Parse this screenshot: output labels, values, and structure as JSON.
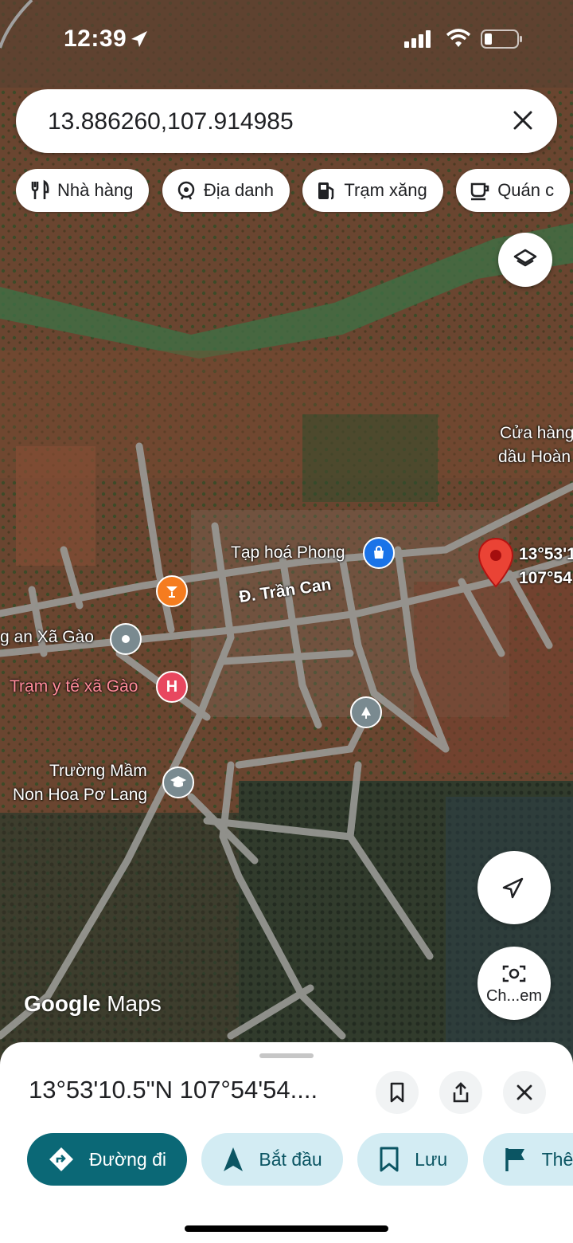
{
  "status_bar": {
    "time": "12:39"
  },
  "search": {
    "value": "13.886260,107.914985"
  },
  "chips": [
    {
      "label": "Nhà hàng",
      "icon": "fork-knife-icon"
    },
    {
      "label": "Địa danh",
      "icon": "landmark-icon"
    },
    {
      "label": "Trạm xăng",
      "icon": "gas-station-icon"
    },
    {
      "label": "Quán c",
      "icon": "coffee-icon"
    }
  ],
  "map": {
    "street_label": "Đ. Trần Can",
    "places": {
      "shop": "Tạp hoá Phong",
      "gas_line1": "Cửa hàng",
      "gas_line2": "dầu Hoàn",
      "police": "g an Xã Gào",
      "clinic": "Trạm y tế xã Gào",
      "school_line1": "Trường Mầm",
      "school_line2": "Non Hoa Pơ Lang"
    },
    "pin_label_line1": "13°53'1(",
    "pin_label_line2": "107°54",
    "attribution_google": "Google",
    "attribution_maps": "Maps",
    "camera_label": "Ch...em"
  },
  "sheet": {
    "title": "13°53'10.5\"N 107°54'54....",
    "actions": [
      {
        "label": "Đường đi",
        "icon": "directions-icon"
      },
      {
        "label": "Bắt đầu",
        "icon": "navigation-arrow-icon"
      },
      {
        "label": "Lưu",
        "icon": "bookmark-icon"
      },
      {
        "label": "Thên",
        "icon": "flag-icon"
      }
    ]
  },
  "colors": {
    "primary": "#0b6876",
    "secondary_bg": "#d3ecf3",
    "pin": "#ea4335"
  }
}
